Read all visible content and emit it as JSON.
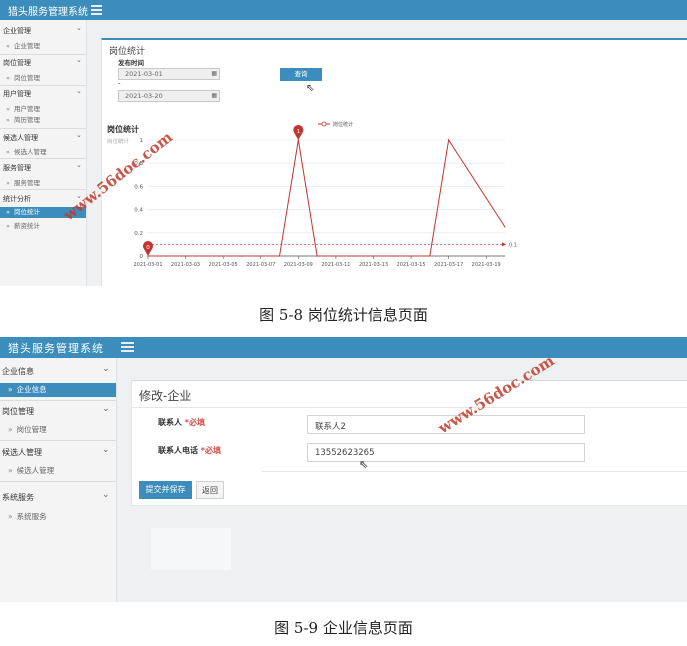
{
  "shot1": {
    "app_title": "猎头服务管理系统",
    "sidebar": [
      {
        "label": "企业管理",
        "items": [
          {
            "label": "企业管理",
            "active": false
          }
        ]
      },
      {
        "label": "岗位管理",
        "items": [
          {
            "label": "岗位管理",
            "active": false
          }
        ]
      },
      {
        "label": "用户管理",
        "items": [
          {
            "label": "用户管理",
            "active": false
          },
          {
            "label": "简历管理",
            "active": false
          }
        ]
      },
      {
        "label": "候选人管理",
        "items": [
          {
            "label": "候选人管理",
            "active": false
          }
        ]
      },
      {
        "label": "服务管理",
        "items": [
          {
            "label": "服务管理",
            "active": false
          }
        ]
      },
      {
        "label": "统计分析",
        "items": [
          {
            "label": "岗位统计",
            "active": true
          },
          {
            "label": "薪资统计",
            "active": false
          }
        ]
      }
    ],
    "page_title": "岗位统计",
    "filter_label": "发布时间",
    "date_from": "2021-03-01",
    "date_separator": "-",
    "date_to": "2021-03-20",
    "query_button": "查询",
    "chart_title": "岗位统计",
    "chart_subtitle": "岗位统计"
  },
  "chart_data": {
    "type": "line",
    "title": "岗位统计",
    "subtitle": "岗位统计",
    "legend": "岗位统计",
    "legend_position": "top-center",
    "grid": true,
    "line_color": "#c23531",
    "x": [
      "2021-03-01",
      "2021-03-02",
      "2021-03-03",
      "2021-03-04",
      "2021-03-05",
      "2021-03-06",
      "2021-03-07",
      "2021-03-08",
      "2021-03-09",
      "2021-03-10",
      "2021-03-11",
      "2021-03-12",
      "2021-03-13",
      "2021-03-14",
      "2021-03-15",
      "2021-03-16",
      "2021-03-17",
      "2021-03-18",
      "2021-03-19",
      "2021-03-20"
    ],
    "x_tick_labels": [
      "2021-03-01",
      "2021-03-03",
      "2021-03-05",
      "2021-03-07",
      "2021-03-09",
      "2021-03-11",
      "2021-03-13",
      "2021-03-15",
      "2021-03-17",
      "2021-03-19"
    ],
    "values": [
      0,
      0,
      0,
      0,
      0,
      0,
      0,
      0,
      1,
      0,
      0,
      0,
      0,
      0,
      0,
      0,
      1,
      0.75,
      0.5,
      0.25
    ],
    "y_ticks": [
      "0",
      "0.2",
      "0.4",
      "0.6",
      "0.8",
      "1"
    ],
    "ylim": [
      0,
      1
    ],
    "markers": [
      {
        "label": "1",
        "kind": "max"
      },
      {
        "label": "0",
        "kind": "min"
      }
    ],
    "average_line_label": "0.1",
    "average_value": 0.1
  },
  "caption1": "图 5-8 岗位统计信息页面",
  "shot2": {
    "app_title": "猎头服务管理系统",
    "sidebar": [
      {
        "label": "企业信息",
        "items": [
          {
            "label": "企业信息",
            "active": true
          }
        ]
      },
      {
        "label": "岗位管理",
        "items": [
          {
            "label": "岗位管理",
            "active": false
          }
        ]
      },
      {
        "label": "候选人管理",
        "items": [
          {
            "label": "候选人管理",
            "active": false
          }
        ]
      },
      {
        "label": "系统服务",
        "items": [
          {
            "label": "系统服务",
            "active": false
          }
        ]
      }
    ],
    "page_title": "修改-企业",
    "fields": [
      {
        "label": "联系人",
        "required": "*必填",
        "value": "联系人2"
      },
      {
        "label": "联系人电话",
        "required": "*必填",
        "value": "13552623265"
      }
    ],
    "submit_button": "提交并保存",
    "back_button": "返回"
  },
  "caption2": "图 5-9 企业信息页面",
  "watermark": "www.56doc.com",
  "colors": {
    "header": "#3c8dbc",
    "accent": "#3c8dbc",
    "series": "#c23531",
    "required": "#d9534f"
  }
}
